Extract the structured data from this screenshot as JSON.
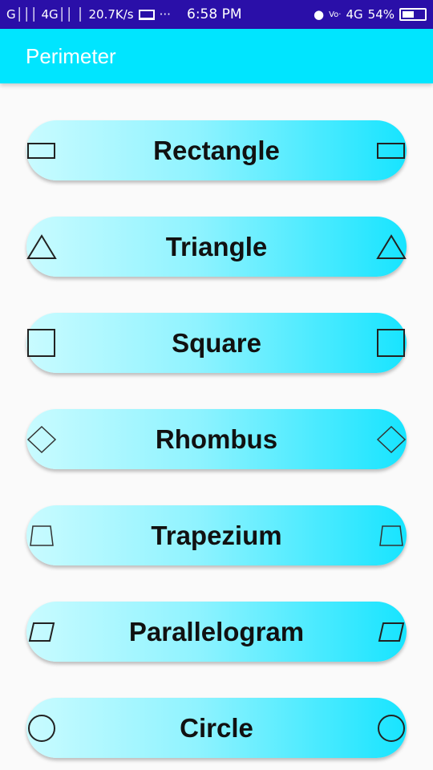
{
  "status_bar": {
    "network_left": "G│││ 4G││ │",
    "speed": "20.7K/s",
    "more": "···",
    "time": "6:58 PM",
    "volte": "Vo·",
    "network_right": "4G",
    "battery": "54%"
  },
  "app_bar": {
    "title": "Perimeter"
  },
  "shapes": [
    {
      "label": "Rectangle",
      "icon": "rectangle-icon"
    },
    {
      "label": "Triangle",
      "icon": "triangle-icon"
    },
    {
      "label": "Square",
      "icon": "square-icon"
    },
    {
      "label": "Rhombus",
      "icon": "rhombus-icon"
    },
    {
      "label": "Trapezium",
      "icon": "trapezium-icon"
    },
    {
      "label": "Parallelogram",
      "icon": "parallelogram-icon"
    },
    {
      "label": "Circle",
      "icon": "circle-icon"
    }
  ],
  "colors": {
    "status_bar": "#2a0fa8",
    "app_bar": "#00e5ff",
    "button_gradient_start": "#c9fbff",
    "button_gradient_end": "#17e4ff",
    "background": "#fafafa"
  }
}
